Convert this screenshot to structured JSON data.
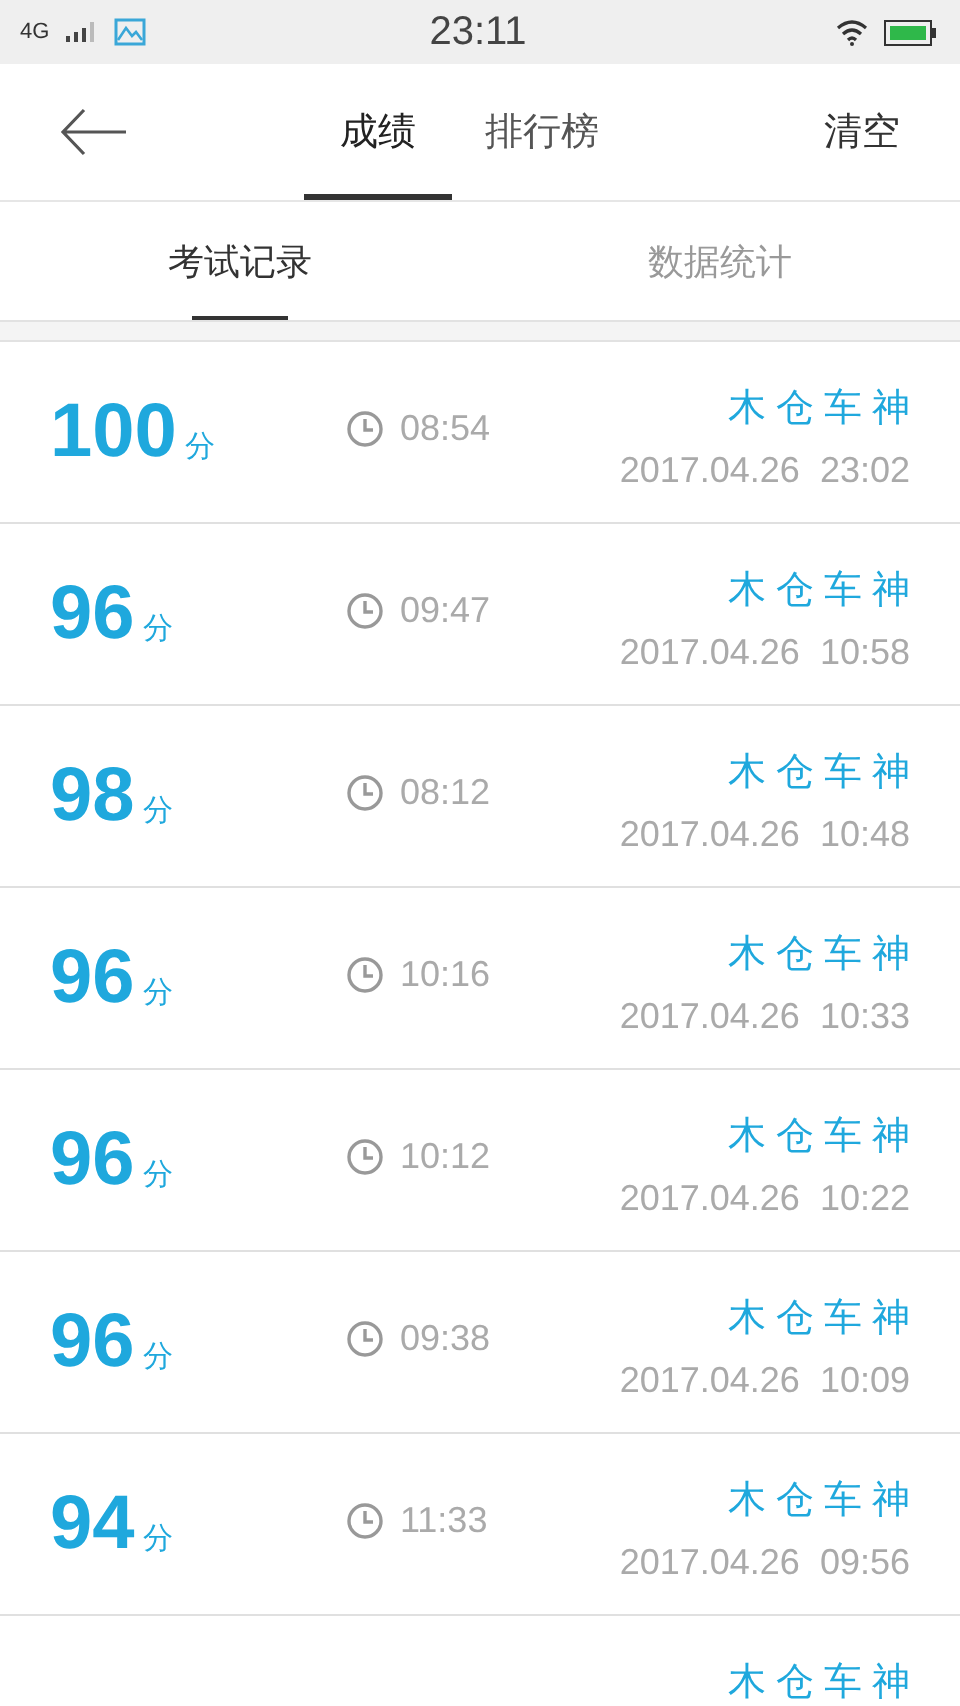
{
  "status_bar": {
    "network": "4G",
    "time": "23:11"
  },
  "header": {
    "tabs": [
      {
        "label": "成绩",
        "selected": true
      },
      {
        "label": "排行榜",
        "selected": false
      }
    ],
    "action": "清空"
  },
  "subtabs": [
    {
      "label": "考试记录",
      "selected": true
    },
    {
      "label": "数据统计",
      "selected": false
    }
  ],
  "records": [
    {
      "score": "100",
      "unit": "分",
      "duration": "08:54",
      "name": "木仓车神",
      "date": "2017.04.26  23:02"
    },
    {
      "score": "96",
      "unit": "分",
      "duration": "09:47",
      "name": "木仓车神",
      "date": "2017.04.26  10:58"
    },
    {
      "score": "98",
      "unit": "分",
      "duration": "08:12",
      "name": "木仓车神",
      "date": "2017.04.26  10:48"
    },
    {
      "score": "96",
      "unit": "分",
      "duration": "10:16",
      "name": "木仓车神",
      "date": "2017.04.26  10:33"
    },
    {
      "score": "96",
      "unit": "分",
      "duration": "10:12",
      "name": "木仓车神",
      "date": "2017.04.26  10:22"
    },
    {
      "score": "96",
      "unit": "分",
      "duration": "09:38",
      "name": "木仓车神",
      "date": "2017.04.26  10:09"
    },
    {
      "score": "94",
      "unit": "分",
      "duration": "11:33",
      "name": "木仓车神",
      "date": "2017.04.26  09:56"
    },
    {
      "name": "木仓车神"
    }
  ]
}
